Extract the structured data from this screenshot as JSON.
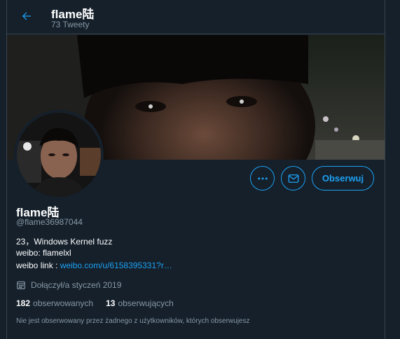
{
  "header": {
    "name": "flame陆",
    "tweet_count": "73 Tweety"
  },
  "icons": {
    "back": "arrow-left-icon",
    "more": "more-horizontal-icon",
    "message": "envelope-icon",
    "calendar": "calendar-icon"
  },
  "actions": {
    "follow_label": "Obserwuj"
  },
  "profile": {
    "name": "flame陆",
    "handle": "@flame36987044",
    "bio_line1": "23，Windows Kernel fuzz",
    "bio_line2": "weibo: flamelxl",
    "bio_line3_prefix": "weibo link : ",
    "bio_link": "weibo.com/u/6158395331?r…",
    "joined": "Dołączył/a styczeń 2019"
  },
  "stats": {
    "following_count": "182",
    "following_label": "obserwowanych",
    "followers_count": "13",
    "followers_label": "obserwujących"
  },
  "note": "Nie jest obserwowany przez żadnego z użytkowników, których obserwujesz",
  "colors": {
    "background": "#15202b",
    "accent": "#1da1f2",
    "secondary_text": "#8899a6",
    "border": "#38444d"
  }
}
